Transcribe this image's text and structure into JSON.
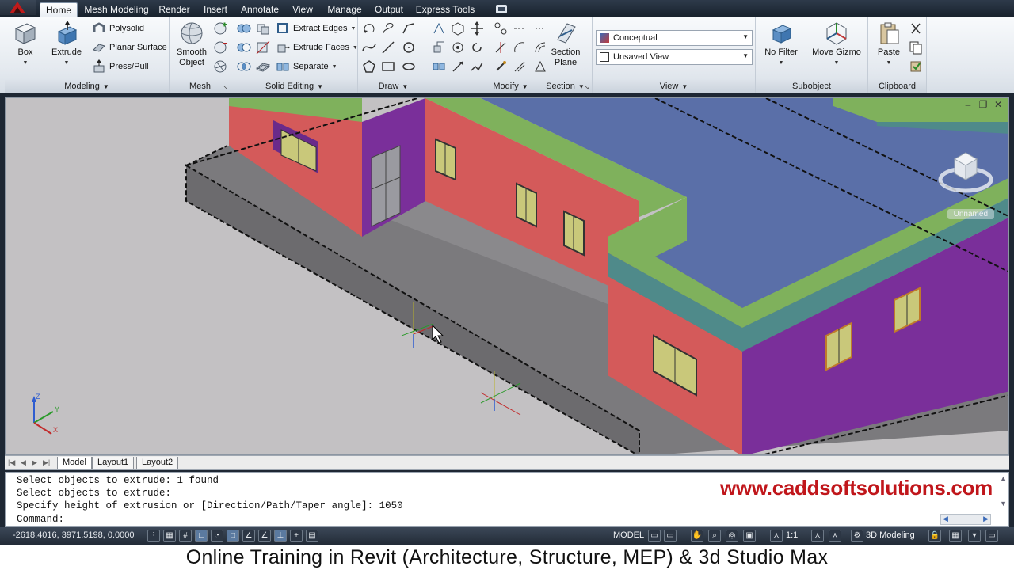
{
  "ribbon_tabs": [
    {
      "label": "Home",
      "active": true
    },
    {
      "label": "Mesh Modeling",
      "active": false
    },
    {
      "label": "Render",
      "active": false
    },
    {
      "label": "Insert",
      "active": false
    },
    {
      "label": "Annotate",
      "active": false
    },
    {
      "label": "View",
      "active": false
    },
    {
      "label": "Manage",
      "active": false
    },
    {
      "label": "Output",
      "active": false
    },
    {
      "label": "Express Tools",
      "active": false
    }
  ],
  "panels": {
    "modeling": {
      "title": "Modeling",
      "box_label": "Box",
      "extrude_label": "Extrude",
      "polysolid_label": "Polysolid",
      "planar_surface_label": "Planar Surface",
      "presspull_label": "Press/Pull"
    },
    "mesh": {
      "title": "Mesh",
      "smooth_object_label_1": "Smooth",
      "smooth_object_label_2": "Object"
    },
    "solid_editing": {
      "title": "Solid Editing",
      "extract_edges_label": "Extract Edges",
      "extrude_faces_label": "Extrude Faces",
      "separate_label": "Separate"
    },
    "draw": {
      "title": "Draw"
    },
    "modify": {
      "title": "Modify"
    },
    "section": {
      "title": "Section",
      "section_plane_label_1": "Section",
      "section_plane_label_2": "Plane"
    },
    "view": {
      "title": "View",
      "visual_style": "Conceptual",
      "named_view": "Unsaved View"
    },
    "subobject": {
      "title": "Subobject",
      "no_filter_label": "No Filter",
      "move_gizmo_label": "Move Gizmo"
    },
    "clipboard": {
      "title": "Clipboard",
      "paste_label": "Paste"
    }
  },
  "viewport": {
    "viewcube_label": "Unnamed",
    "colors": {
      "background": "#c3c1c3",
      "wall_red": "#d45a5a",
      "wall_purple": "#7a2f9a",
      "roof_slab": "#5a6fa8",
      "parapet_green": "#7fb15c",
      "window_glass": "#c9c87a",
      "slab_gray": "#7b7a7d"
    }
  },
  "layout_tabs": [
    {
      "label": "Model",
      "active": true
    },
    {
      "label": "Layout1",
      "active": false
    },
    {
      "label": "Layout2",
      "active": false
    }
  ],
  "command": {
    "history": [
      "Select objects to extrude: 1 found",
      "Select objects to extrude:",
      "Specify height of extrusion or [Direction/Path/Taper angle]: 1050"
    ],
    "prompt": "Command:",
    "watermark": "www.caddsoftsolutions.com"
  },
  "status": {
    "coordinates": "-2618.4016, 3971.5198, 0.0000",
    "space": "MODEL",
    "annotation_scale": "1:1",
    "workspace": "3D Modeling"
  },
  "caption": "Online Training in Revit (Architecture, Structure, MEP) & 3d Studio Max"
}
